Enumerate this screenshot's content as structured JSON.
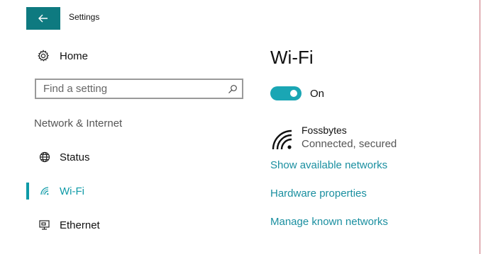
{
  "window": {
    "title": "Settings",
    "back_icon": "back-arrow-icon",
    "accent_color": "#0e7a80"
  },
  "sidebar": {
    "home_label": "Home",
    "home_icon": "gear-icon",
    "search": {
      "placeholder": "Find a setting",
      "value": "",
      "icon": "search-icon"
    },
    "section_label": "Network & Internet",
    "items": [
      {
        "label": "Status",
        "icon": "globe-icon",
        "active": false
      },
      {
        "label": "Wi-Fi",
        "icon": "wifi-icon",
        "active": true
      },
      {
        "label": "Ethernet",
        "icon": "ethernet-icon",
        "active": false
      }
    ],
    "active_color": "#0e9aa7"
  },
  "main": {
    "title": "Wi-Fi",
    "toggle": {
      "state": "On",
      "on": true,
      "color": "#1aa6b4"
    },
    "network": {
      "name": "Fossbytes",
      "status": "Connected, secured",
      "icon": "wifi-signal-icon"
    },
    "links": {
      "show_available": "Show available networks",
      "hardware_properties": "Hardware properties",
      "manage_known": "Manage known networks"
    },
    "link_color": "#1a8fa0"
  }
}
